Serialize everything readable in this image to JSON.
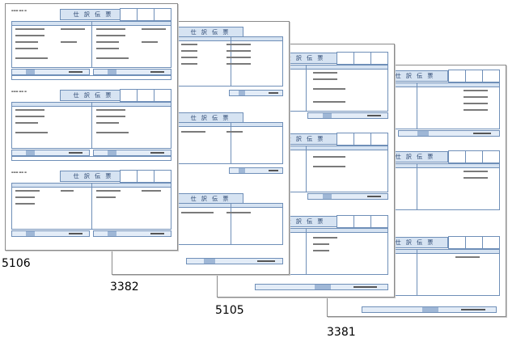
{
  "documents": [
    {
      "id": "doc-5106",
      "label": "5106",
      "vouchers": 3
    },
    {
      "id": "doc-3382",
      "label": "3382",
      "vouchers": 3
    },
    {
      "id": "doc-5105",
      "label": "5105",
      "vouchers": 3
    },
    {
      "id": "doc-3381",
      "label": "3381",
      "vouchers": 3
    }
  ],
  "voucher_title": "仕 訳 伝 票",
  "colors": {
    "accent": "#6f8fb8",
    "header_fill": "#d6e3f2",
    "total_fill": "#9fb7d6",
    "green_text": "#3a9a3a",
    "page_border": "#8a8a8a"
  }
}
